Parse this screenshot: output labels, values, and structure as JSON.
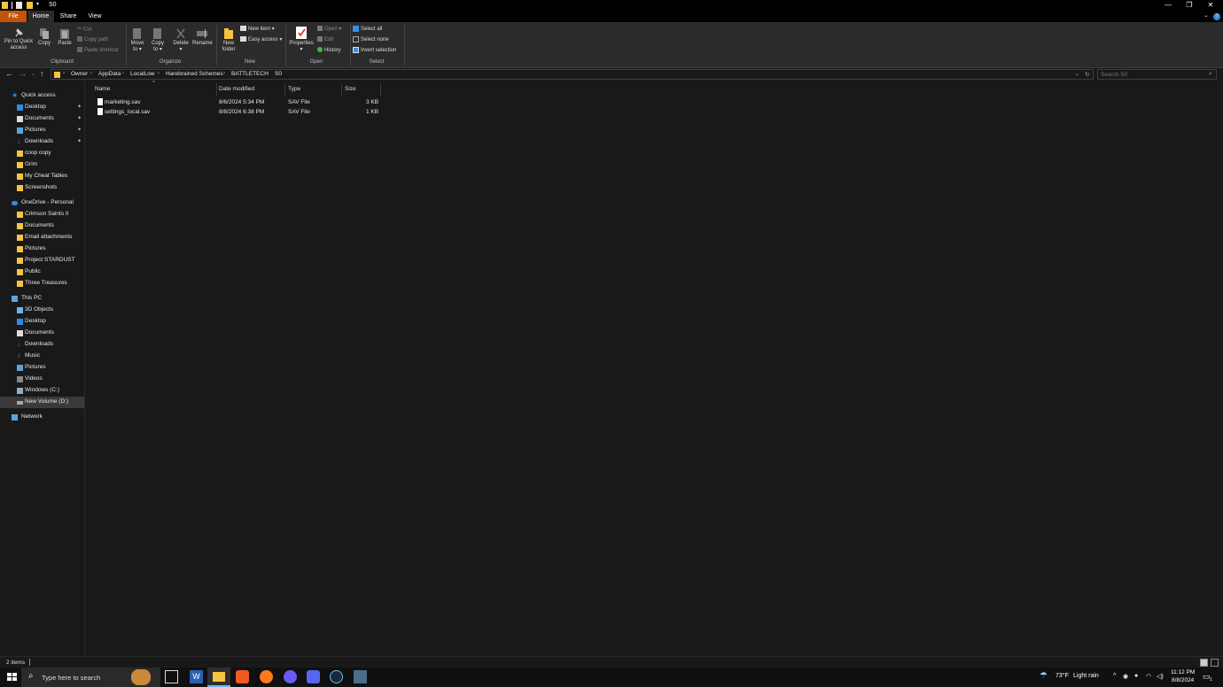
{
  "window": {
    "title": "S0",
    "minimize": "—",
    "restore": "❐",
    "close": "✕"
  },
  "tabs": {
    "file": "File",
    "home": "Home",
    "share": "Share",
    "view": "View"
  },
  "ribbon": {
    "clipboard": {
      "pin_line1": "Pin to Quick",
      "pin_line2": "access",
      "copy": "Copy",
      "paste": "Paste",
      "cut": "Cut",
      "copy_path": "Copy path",
      "paste_shortcut": "Paste shortcut",
      "group": "Clipboard"
    },
    "organize": {
      "move_line1": "Move",
      "move_line2": "to ▾",
      "copy_line1": "Copy",
      "copy_line2": "to ▾",
      "delete": "Delete",
      "delete_arrow": "▾",
      "rename": "Rename",
      "group": "Organize"
    },
    "new": {
      "folder_line1": "New",
      "folder_line2": "folder",
      "new_item": "New item ▾",
      "easy_access": "Easy access ▾",
      "group": "New"
    },
    "open": {
      "properties": "Properties",
      "properties_arrow": "▾",
      "open": "Open ▾",
      "edit": "Edit",
      "history": "History",
      "group": "Open"
    },
    "select": {
      "select_all": "Select all",
      "select_none": "Select none",
      "invert": "Invert selection",
      "group": "Select"
    }
  },
  "address": {
    "crumbs": [
      "Owner",
      "AppData",
      "LocalLow",
      "Harebrained Schemes",
      "BATTLETECH",
      "S0"
    ],
    "separator": "›",
    "search_placeholder": "Search S0"
  },
  "nav": {
    "quick_access": "Quick access",
    "quick_items": [
      "Desktop",
      "Documents",
      "Pictures",
      "Downloads",
      "coop copy",
      "Grim",
      "My Cheat Tables",
      "Screenshots"
    ],
    "onedrive": "OneDrive - Personal",
    "onedrive_items": [
      "Crimson Saints II",
      "Documents",
      "Email attachments",
      "Pictures",
      "Project STARDUST",
      "Public",
      "Three Treasures"
    ],
    "this_pc": "This PC",
    "pc_items": [
      "3D Objects",
      "Desktop",
      "Documents",
      "Downloads",
      "Music",
      "Pictures",
      "Videos",
      "Windows (C:)",
      "New Volume (D:)"
    ],
    "network": "Network",
    "pin_glyph": "📌"
  },
  "files": {
    "columns": [
      "Name",
      "Date modified",
      "Type",
      "Size"
    ],
    "sort_glyph": "^",
    "rows": [
      {
        "name": "marketing.sav",
        "date": "8/6/2024 5:34 PM",
        "type": "SAV File",
        "size": "3 KB"
      },
      {
        "name": "settings_local.sav",
        "date": "8/8/2024 6:38 PM",
        "type": "SAV File",
        "size": "1 KB"
      }
    ]
  },
  "status": {
    "count": "2 items"
  },
  "taskbar": {
    "search_placeholder": "Type here to search",
    "weather_temp": "73°F",
    "weather_desc": "Light rain",
    "time": "11:12 PM",
    "date": "8/8/2024",
    "notification_count": "1"
  },
  "colors": {
    "accent_file_tab": "#c2540a",
    "folder": "#f5c542",
    "blue_icon": "#2f8ae0"
  }
}
